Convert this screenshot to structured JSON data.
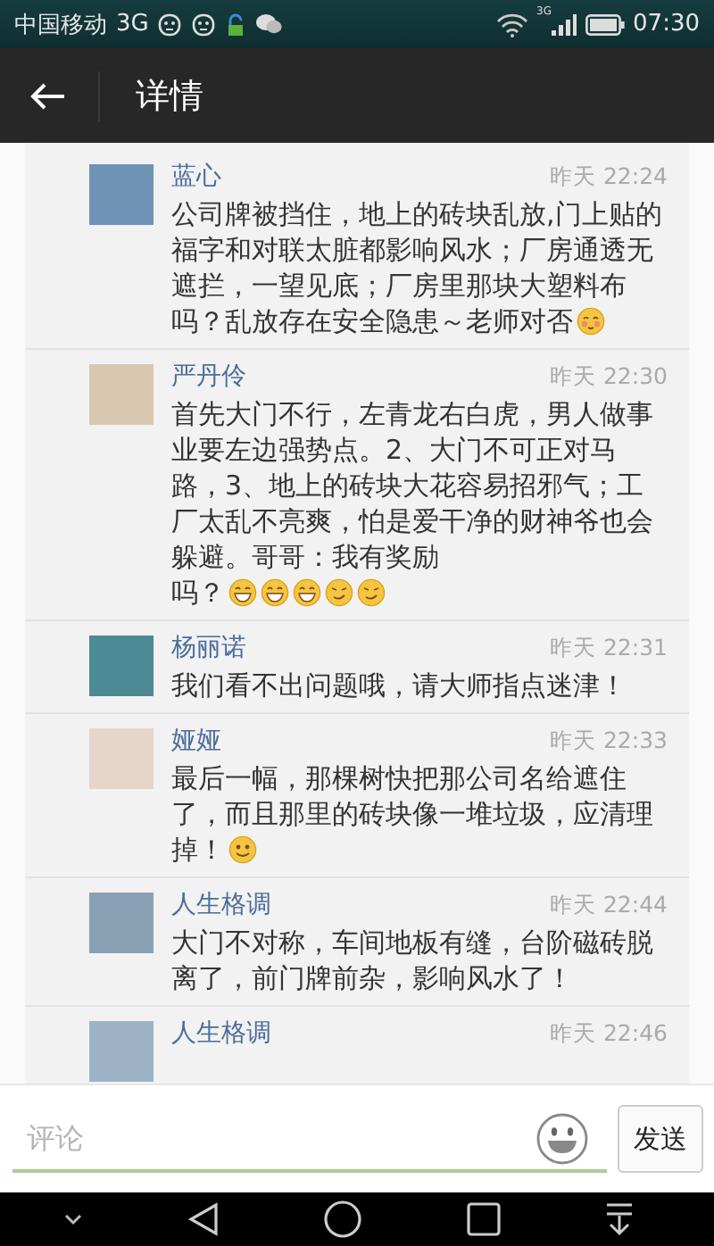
{
  "status_bar": {
    "carrier": "中国移动",
    "network": "3G",
    "signal_network": "3G",
    "time": "07:30"
  },
  "header": {
    "title": "详情"
  },
  "comments": [
    {
      "name": "蓝心",
      "time": "昨天 22:24",
      "text": "公司牌被挡住，地上的砖块乱放,门上贴的福字和对联太脏都影响风水；厂房通透无遮拦，一望见底；厂房里那块大塑料布",
      "tail": "吗？乱放存在安全隐患～老师对否",
      "emojis": [
        {
          "kind": "blush"
        }
      ]
    },
    {
      "name": "严丹伶",
      "time": "昨天 22:30",
      "text": "首先大门不行，左青龙右白虎，男人做事业要左边强势点。2、大门不可正对马路，3、地上的砖块大花容易招邪气；工厂太乱不亮爽，怕是爱干净的财神爷也会躲避。哥哥：我有奖励",
      "tail": "吗？",
      "emojis": [
        {
          "kind": "grin"
        },
        {
          "kind": "grin"
        },
        {
          "kind": "grin"
        },
        {
          "kind": "smirk"
        },
        {
          "kind": "smirk"
        }
      ]
    },
    {
      "name": "杨丽诺",
      "time": "昨天 22:31",
      "text": "我们看不出问题哦，请大师指点迷津！"
    },
    {
      "name": "娅娅",
      "time": "昨天 22:33",
      "text": "最后一幅，那棵树快把那公司名给遮住了，而且那里的砖块像一堆垃圾，应清理",
      "tail": "掉！",
      "emojis": [
        {
          "kind": "smile"
        }
      ]
    },
    {
      "name": "人生格调",
      "time": "昨天 22:44",
      "text": "大门不对称，车间地板有缝，台阶磁砖脱离了，前门牌前杂，影响风水了！"
    },
    {
      "name": "人生格调",
      "time": "昨天 22:46"
    }
  ],
  "input": {
    "placeholder": "评论",
    "send": "发送"
  }
}
